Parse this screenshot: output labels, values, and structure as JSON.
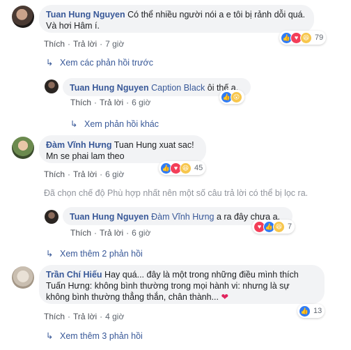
{
  "comments": [
    {
      "author": "Tuan Hung Nguyen",
      "text1": " Có thể nhiều người nói a e tôi bị rảnh dỗi quá.",
      "text2": "Và hơi Hâm í.",
      "like": "Thích",
      "reply": "Trả lời",
      "time": "7 giờ",
      "reactions": [
        "like-icon",
        "love-icon",
        "haha-icon"
      ],
      "count": "79"
    },
    {
      "author": "Tuan Hung Nguyen",
      "mention": "Caption Black",
      "text1": " ôi thế ạ.",
      "like": "Thích",
      "reply": "Trả lời",
      "time": "6 giờ",
      "reactions": [
        "like-icon",
        "wow-icon"
      ]
    },
    {
      "author": "Đàm Vĩnh Hưng",
      "text1": " Tuan Hung xuat sac!",
      "text2": "Mn se phai lam theo",
      "like": "Thích",
      "reply": "Trả lời",
      "time": "6 giờ",
      "reactions": [
        "like-icon",
        "love-icon",
        "haha-icon"
      ],
      "count": "45"
    },
    {
      "author": "Tuan Hung Nguyen",
      "mention": "Đàm Vĩnh Hưng",
      "text1": " a ra đây chưa a.",
      "like": "Thích",
      "reply": "Trả lời",
      "time": "6 giờ",
      "reactions": [
        "love-icon",
        "like-icon",
        "haha-icon"
      ],
      "count": "7"
    },
    {
      "author": "Trần Chí Hiếu",
      "text1": " Hay quá... đây là một trong những điều mình thích",
      "text2": "Tuấn Hưng: không bình thường trong mọi hành vi: nhưng là sự",
      "text3": "không bình thường thẳng thắn, chân thành... ",
      "heart": "❤",
      "like": "Thích",
      "reply": "Trả lời",
      "time": "4 giờ",
      "reactions": [
        "like-icon"
      ],
      "count": "13"
    }
  ],
  "links": {
    "previous": "Xem các phản hồi trước",
    "other": "Xem phản hồi khác",
    "more2": "Xem thêm 2 phản hồi",
    "more3": "Xem thêm 3 phản hồi"
  },
  "filter_note": "Đã chọn chế độ Phù hợp nhất nên một số câu trả lời có thể bị lọc ra.",
  "colors": {
    "link": "#385898",
    "bubble": "#f2f3f5",
    "like": "#2f7cf6",
    "love": "#f33e58",
    "haha": "#f7c64c"
  }
}
